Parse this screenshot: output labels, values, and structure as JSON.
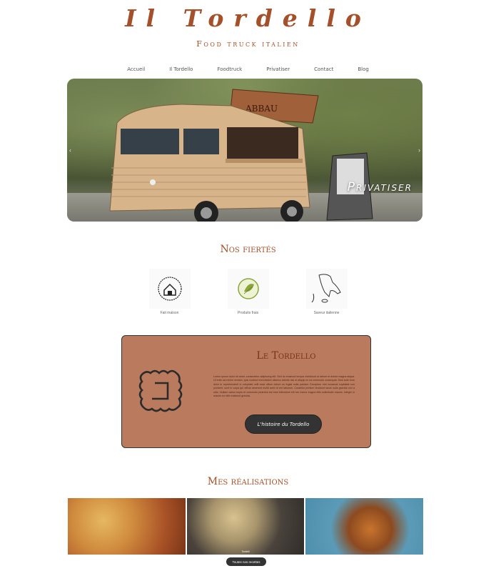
{
  "site": {
    "logo": "Il Tordello",
    "tagline": "Food truck italien"
  },
  "nav": {
    "items": [
      {
        "label": "Accueil"
      },
      {
        "label": "Il Tordello"
      },
      {
        "label": "Foodtruck"
      },
      {
        "label": "Privatiser"
      },
      {
        "label": "Contact"
      },
      {
        "label": "Blog"
      }
    ]
  },
  "hero": {
    "caption": "Privatiser",
    "truck_sign": "ABBAU",
    "prev_icon": "chevron-left-icon",
    "next_icon": "chevron-right-icon"
  },
  "prides": {
    "title": "Nos fiertés",
    "items": [
      {
        "label": "Fait maison",
        "icon": "house-icon"
      },
      {
        "label": "Produits frais",
        "icon": "fresh-leaf-icon"
      },
      {
        "label": "Saveur italienne",
        "icon": "italy-map-icon"
      }
    ]
  },
  "story": {
    "title": "Le Tordello",
    "text": "Lorem ipsum dolor sit amet, consectetur adipiscing elit. Sed do eiusmod tempor incididunt ut labore et dolore magna aliqua. Ut enim ad minim veniam, quis nostrud exercitation ullamco laboris nisi ut aliquip ex ea commodo consequat. Duis aute irure dolor in reprehenderit in voluptate velit esse cillum dolore eu fugiat nulla pariatur. Excepteur sint occaecat cupidatat non proident, sunt in culpa qui officia deserunt mollit anim id est laborum. Curabitur pretium tincidunt lacus nulla gravida orci a odio. Nullam varius turpis et commodo pharetra est eros bibendum elit nec luctus magna felis sollicitudin mauris. Integer in mauris eu nibh euismod gravida.",
    "button": "L'histoire du Tordello",
    "icon": "tordello-pasta-icon"
  },
  "realisations": {
    "title": "Mes réalisations",
    "photos": [
      {
        "alt": "tordelli-sauce-photo"
      },
      {
        "alt": "tordelli-raw-photo",
        "label": "Tordelli"
      },
      {
        "alt": "tordelli-plate-photo"
      }
    ],
    "button": "Toutes nos recettes"
  },
  "colors": {
    "brand": "#a4502a",
    "card_bg": "#ba7a5d",
    "button_dark": "#333333"
  }
}
